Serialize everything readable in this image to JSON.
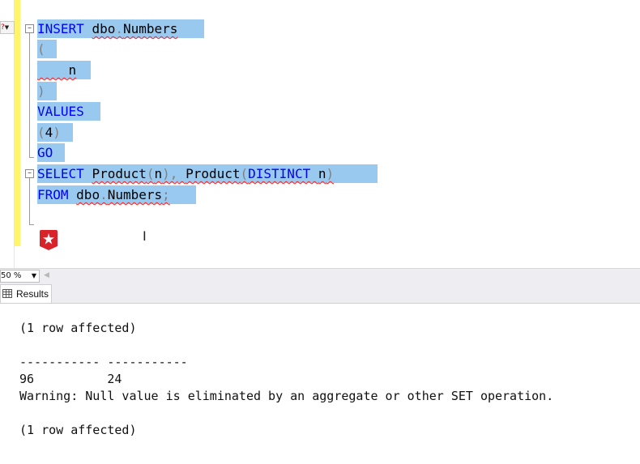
{
  "editor": {
    "gutter_dropdown_label": "?",
    "lines": {
      "l1_kw": "INSERT",
      "l1_obj_a": "dbo",
      "l1_dot": ".",
      "l1_obj_b": "Numbers",
      "l2": "(",
      "l3": "    n",
      "l4": ")",
      "l5": "VALUES",
      "l6_open": "(",
      "l6_val": "4",
      "l6_close": ")",
      "l7": "GO",
      "l8_kw": "SELECT",
      "l8_fn1": "Product",
      "l8_p1o": "(",
      "l8_arg1": "n",
      "l8_p1c": "),",
      "l8_fn2": "Product",
      "l8_p2o": "(",
      "l8_kw2": "DISTINCT",
      "l8_arg2": "n",
      "l8_p2c": ")",
      "l9_kw": "FROM",
      "l9_obj_a": "dbo",
      "l9_dot": ".",
      "l9_obj_b": "Numbers",
      "l9_semi": ";"
    },
    "cursor_glyph": "I"
  },
  "zoom": {
    "value": "50 %"
  },
  "tabs": {
    "results_label": "Results"
  },
  "results": {
    "line1": "(1 row affected)",
    "line2": "----------- -----------",
    "line3": "96          24",
    "line4": "Warning: Null value is eliminated by an aggregate or other SET operation.",
    "line5": "(1 row affected)"
  },
  "colors": {
    "selection": "#99c9ef",
    "keyword": "#0000ff",
    "punctuation": "#808080",
    "change_bar": "#fff46b",
    "squiggle": "#ff2020"
  }
}
